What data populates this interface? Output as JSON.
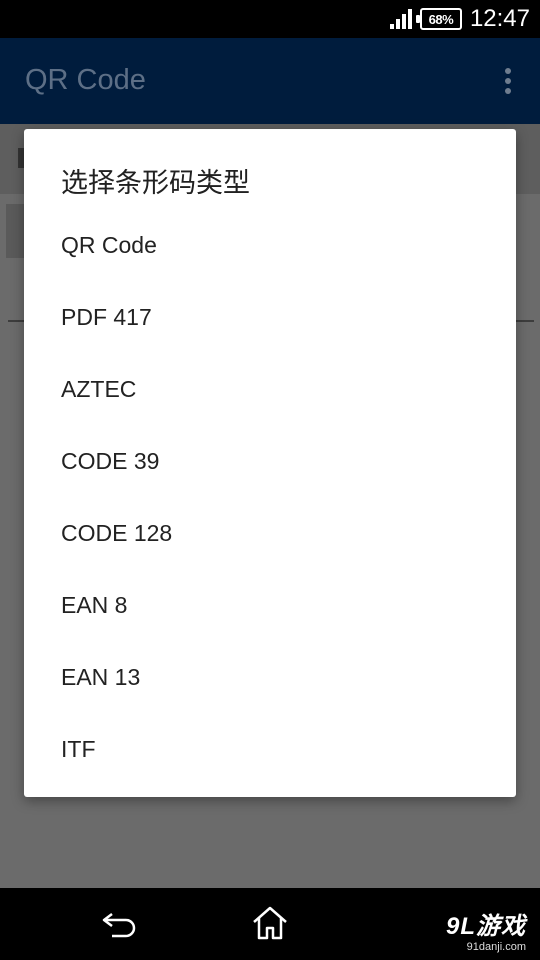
{
  "status_bar": {
    "battery": "68%",
    "time": "12:47"
  },
  "app": {
    "title": "QR Code"
  },
  "dialog": {
    "title": "选择条形码类型",
    "options": [
      "QR Code",
      "PDF 417",
      "AZTEC",
      "CODE 39",
      "CODE 128",
      "EAN 8",
      "EAN 13",
      "ITF"
    ]
  },
  "watermark": {
    "logo": "9L游戏",
    "site": "91danji.com"
  },
  "colors": {
    "appbar": "#001c3d",
    "dim_background": "#6b6b6b",
    "dialog_bg": "#ffffff"
  }
}
